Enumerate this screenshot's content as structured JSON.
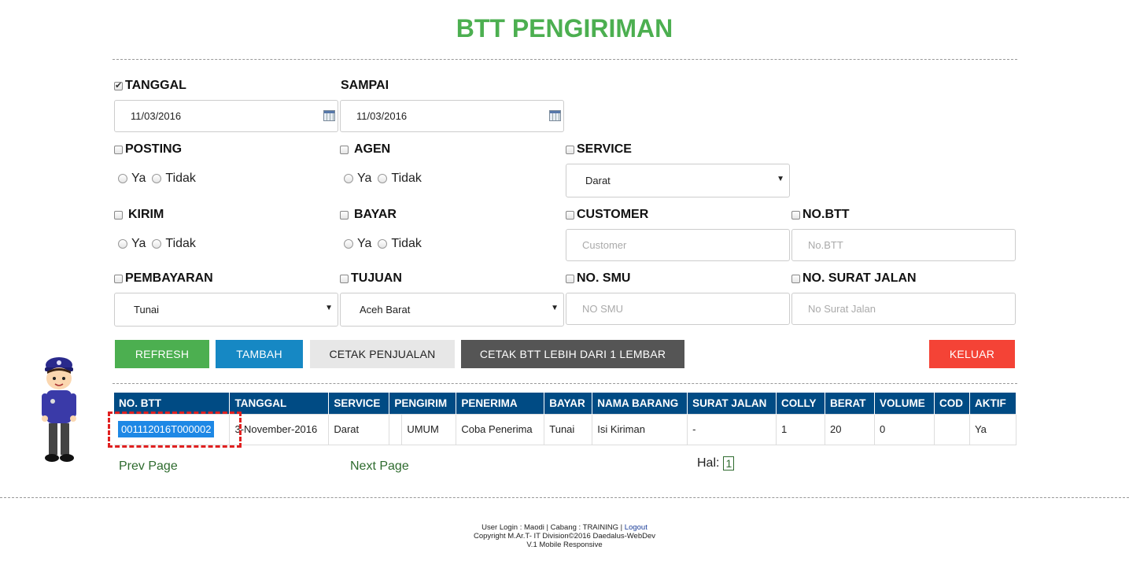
{
  "page": {
    "title": "BTT PENGIRIMAN"
  },
  "filters": {
    "tanggal": {
      "label": "TANGGAL",
      "checked": true,
      "value": "11/03/2016"
    },
    "sampai": {
      "label": "SAMPAI",
      "value": "11/03/2016"
    },
    "posting": {
      "label": "POSTING",
      "yes": "Ya",
      "no": "Tidak"
    },
    "agen": {
      "label": "AGEN",
      "yes": "Ya",
      "no": "Tidak"
    },
    "service": {
      "label": "SERVICE",
      "value": "Darat"
    },
    "kirim": {
      "label": "KIRIM",
      "yes": "Ya",
      "no": "Tidak"
    },
    "bayar": {
      "label": "BAYAR",
      "yes": "Ya",
      "no": "Tidak"
    },
    "customer": {
      "label": "CUSTOMER",
      "placeholder": "Customer"
    },
    "no_btt": {
      "label": "NO.BTT",
      "placeholder": "No.BTT"
    },
    "pembayaran": {
      "label": "PEMBAYARAN",
      "value": "Tunai"
    },
    "tujuan": {
      "label": "TUJUAN",
      "value": "Aceh Barat"
    },
    "no_smu": {
      "label": "NO. SMU",
      "placeholder": "NO SMU"
    },
    "no_surat_jalan": {
      "label": "NO. SURAT JALAN",
      "placeholder": "No Surat Jalan"
    }
  },
  "buttons": {
    "refresh": "REFRESH",
    "tambah": "TAMBAH",
    "cetak_penjualan": "CETAK PENJUALAN",
    "cetak_btt": "CETAK BTT LEBIH DARI 1 LEMBAR",
    "keluar": "KELUAR"
  },
  "colors": {
    "title": "#4caf50",
    "refresh": "#4caf50",
    "tambah": "#1688c4",
    "cetak_penjualan": "#e7e7e7",
    "cetak_btt": "#555555",
    "keluar": "#f44336",
    "table_header": "#004b84"
  },
  "table": {
    "headers": [
      "NO. BTT",
      "TANGGAL",
      "SERVICE",
      "PENGIRIM",
      "PENERIMA",
      "BAYAR",
      "NAMA BARANG",
      "SURAT JALAN",
      "COLLY",
      "BERAT",
      "VOLUME",
      "COD",
      "AKTIF"
    ],
    "rows": [
      {
        "no_btt": "001112016T000002",
        "tanggal": "3-November-2016",
        "service": "Darat",
        "pengirim": "UMUM",
        "penerima": "Coba Penerima",
        "bayar": "Tunai",
        "nama_barang": "Isi Kiriman",
        "surat_jalan": "-",
        "colly": "1",
        "berat": "20",
        "volume": "0",
        "cod": "",
        "aktif": "Ya"
      }
    ]
  },
  "pager": {
    "prev": "Prev Page",
    "next": "Next Page",
    "hal_label": "Hal:",
    "current": "1"
  },
  "footer": {
    "line1_prefix": "User Login : Maodi | Cabang : TRAINING | ",
    "logout": "Logout",
    "line2": "Copyright M.Ar.T- IT Division©2016 Daedalus-WebDev",
    "line3": "V.1 Mobile Responsive"
  }
}
